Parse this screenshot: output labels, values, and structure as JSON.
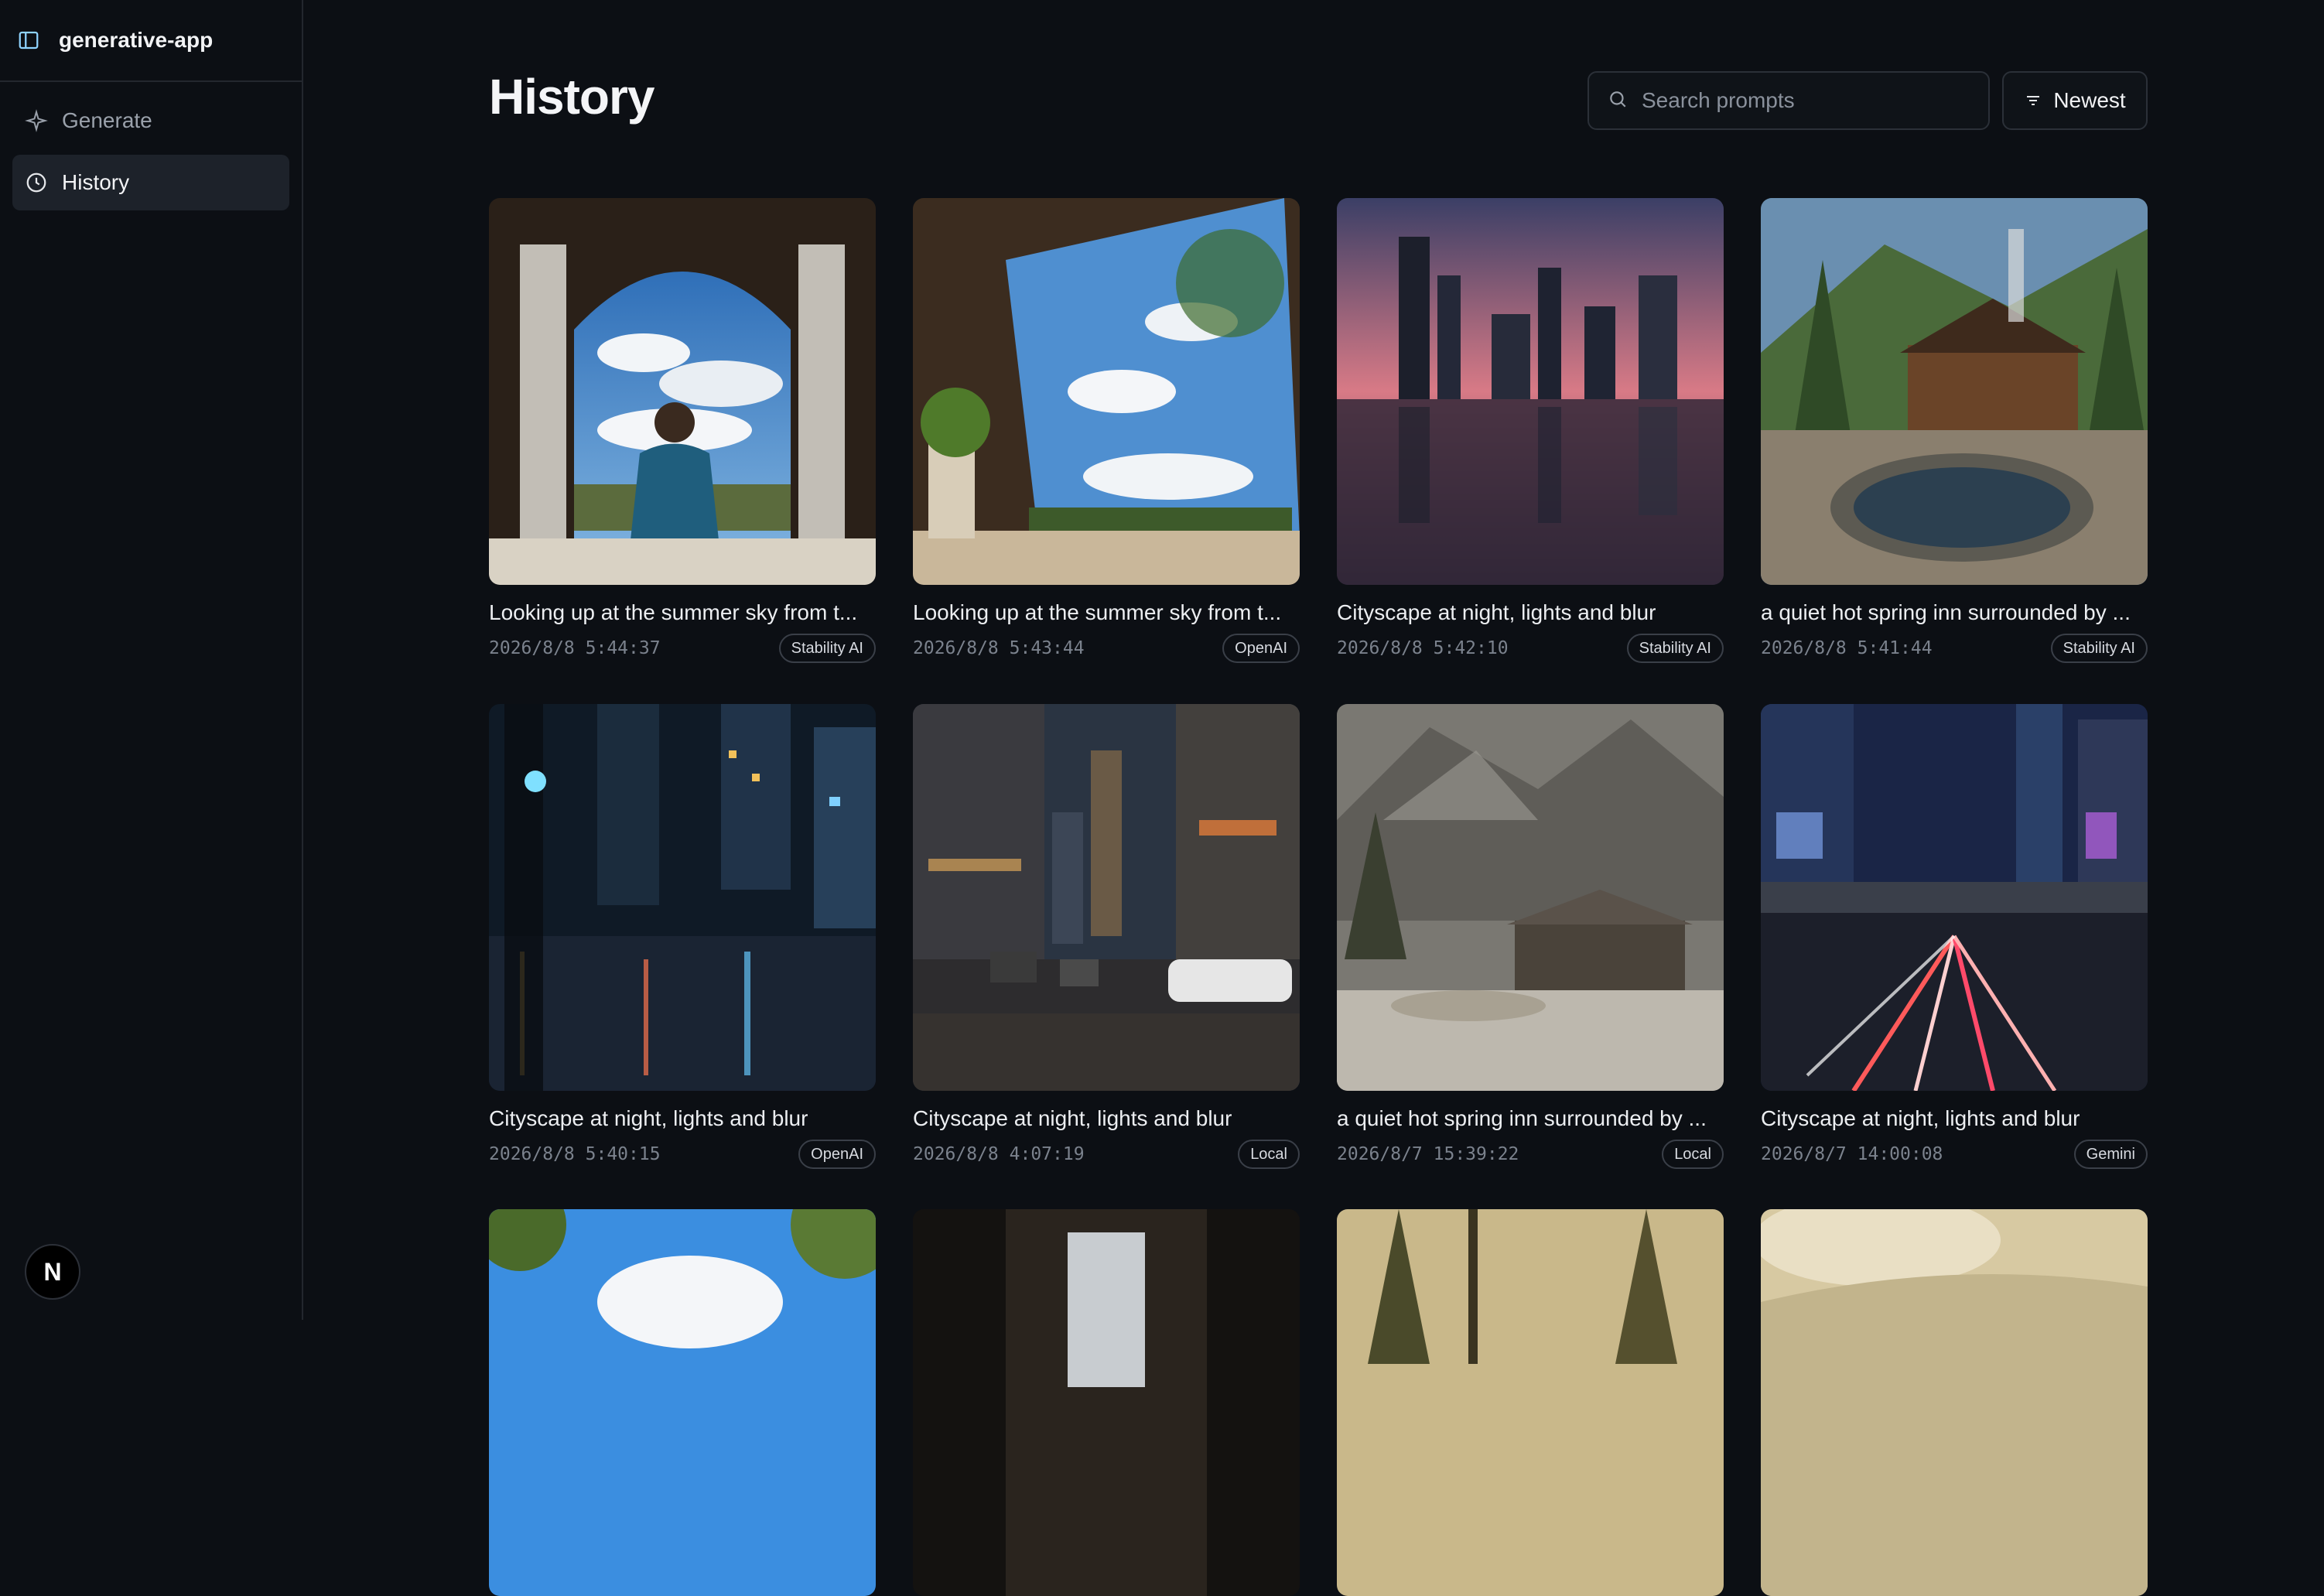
{
  "app": {
    "name": "generative-app"
  },
  "sidebar": {
    "items": [
      {
        "label": "Generate",
        "icon": "sparkle-icon",
        "active": false
      },
      {
        "label": "History",
        "icon": "clock-icon",
        "active": true
      }
    ],
    "avatar_letter": "N"
  },
  "header": {
    "title": "History",
    "search_placeholder": "Search prompts",
    "sort_label": "Newest"
  },
  "cards": [
    {
      "caption": "Looking up at the summer sky from t...",
      "timestamp": "2026/8/8 5:44:37",
      "provider": "Stability AI"
    },
    {
      "caption": "Looking up at the summer sky from t...",
      "timestamp": "2026/8/8 5:43:44",
      "provider": "OpenAI"
    },
    {
      "caption": "Cityscape at night, lights and blur",
      "timestamp": "2026/8/8 5:42:10",
      "provider": "Stability AI"
    },
    {
      "caption": "a quiet hot spring inn surrounded by ...",
      "timestamp": "2026/8/8 5:41:44",
      "provider": "Stability AI"
    },
    {
      "caption": "Cityscape at night, lights and blur",
      "timestamp": "2026/8/8 5:40:15",
      "provider": "OpenAI"
    },
    {
      "caption": "Cityscape at night, lights and blur",
      "timestamp": "2026/8/8 4:07:19",
      "provider": "Local"
    },
    {
      "caption": "a quiet hot spring inn surrounded by ...",
      "timestamp": "2026/8/7 15:39:22",
      "provider": "Local"
    },
    {
      "caption": "Cityscape at night, lights and blur",
      "timestamp": "2026/8/7 14:00:08",
      "provider": "Gemini"
    }
  ],
  "colors": {
    "background": "#0c0f14",
    "sidebar_active": "#1d222a",
    "border": "#2b3038"
  }
}
